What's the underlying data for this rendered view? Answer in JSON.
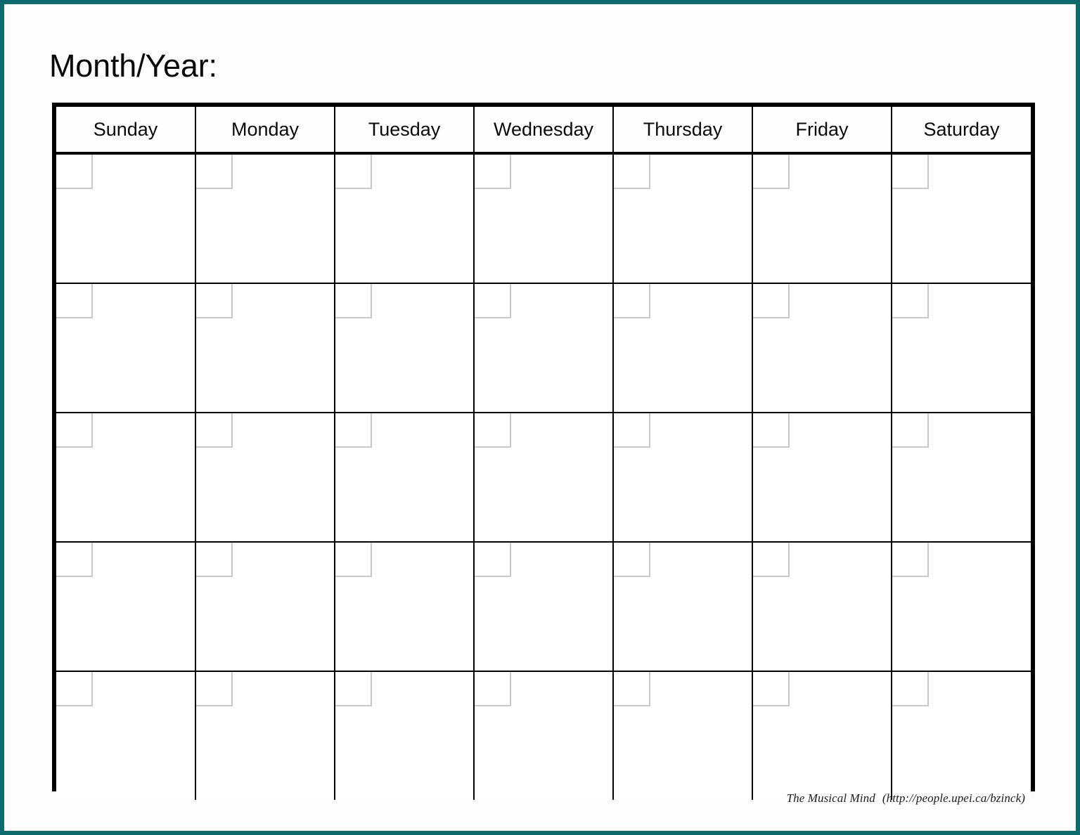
{
  "page": {
    "title_label": "Month/Year:",
    "frame_color": "#0d6b6e",
    "grid_border_color": "#000000",
    "date_box_color": "#c9c9c9",
    "background_color": "#ffffff"
  },
  "calendar": {
    "weekday_headers": [
      "Sunday",
      "Monday",
      "Tuesday",
      "Wednesday",
      "Thursday",
      "Friday",
      "Saturday"
    ],
    "row_count": 5,
    "column_count": 7,
    "cells": [
      [
        "",
        "",
        "",
        "",
        "",
        "",
        ""
      ],
      [
        "",
        "",
        "",
        "",
        "",
        "",
        ""
      ],
      [
        "",
        "",
        "",
        "",
        "",
        "",
        ""
      ],
      [
        "",
        "",
        "",
        "",
        "",
        "",
        ""
      ],
      [
        "",
        "",
        "",
        "",
        "",
        "",
        ""
      ]
    ]
  },
  "footer": {
    "credit_name": "The Musical Mind",
    "credit_url": "(http://people.upei.ca/bzinck)"
  }
}
